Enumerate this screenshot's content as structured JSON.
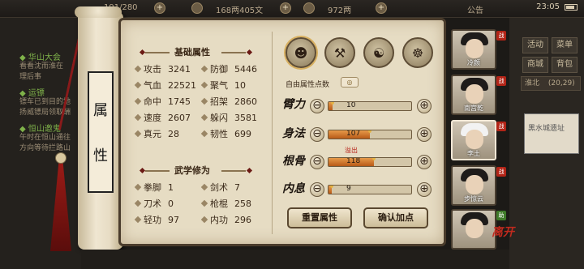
{
  "topbar": {
    "energy": "191/280",
    "money": "168两405文",
    "gold": "972两",
    "notice": "公告",
    "time": "23:05",
    "plus": "+"
  },
  "quests": [
    {
      "title": "◆ 华山大会",
      "desc": "看看沈而淮在\n理后事"
    },
    {
      "title": "◆ 运镖",
      "desc": "镖车已到目的地\n扬威镖局领取酬"
    },
    {
      "title": "◆ 恒山邀鬼",
      "desc": "午时在恒山通往\n方向等待拦路山"
    }
  ],
  "right_menu": {
    "activity": "活动",
    "grade": "菜单",
    "shop": "商城",
    "bag": "背包",
    "location": "淮北",
    "coords": "(20,29)",
    "box_text": "黑水城遗址"
  },
  "scroll": {
    "chars": [
      "属",
      "性"
    ]
  },
  "base_attrs": {
    "title": "基础属性",
    "items": [
      {
        "label": "攻击",
        "value": "3241"
      },
      {
        "label": "防御",
        "value": "5446"
      },
      {
        "label": "气血",
        "value": "22521"
      },
      {
        "label": "聚气",
        "value": "10"
      },
      {
        "label": "命中",
        "value": "1745"
      },
      {
        "label": "招架",
        "value": "2860"
      },
      {
        "label": "速度",
        "value": "2607"
      },
      {
        "label": "躲闪",
        "value": "3581"
      },
      {
        "label": "真元",
        "value": "28"
      },
      {
        "label": "韧性",
        "value": "699"
      }
    ]
  },
  "martial": {
    "title": "武学修为",
    "items": [
      {
        "label": "拳脚",
        "value": "1"
      },
      {
        "label": "剑术",
        "value": "7"
      },
      {
        "label": "刀术",
        "value": "0"
      },
      {
        "label": "枪棍",
        "value": "258"
      },
      {
        "label": "轻功",
        "value": "97"
      },
      {
        "label": "内功",
        "value": "296"
      }
    ]
  },
  "free_points": {
    "label": "自由属性点数",
    "value": "◎"
  },
  "allocs": [
    {
      "label": "臂力",
      "value": "10",
      "fill": 0.05
    },
    {
      "label": "身法",
      "value": "107",
      "fill": 0.5
    },
    {
      "label": "根骨",
      "value": "118",
      "fill": 0.55
    },
    {
      "label": "内息",
      "value": "9",
      "fill": 0.04
    }
  ],
  "overflow_label": "溢出",
  "buttons": {
    "reset": "重置属性",
    "confirm": "确认加点",
    "minus": "⊖",
    "plus": "⊕"
  },
  "party": [
    {
      "name": "冷颜",
      "badge": "战"
    },
    {
      "name": "南宫乾",
      "badge": "战"
    },
    {
      "name": "李土",
      "badge": "战"
    },
    {
      "name": "步惊云",
      "badge": "战"
    },
    {
      "name": "",
      "badge": "助"
    }
  ],
  "leave_label": "离开"
}
